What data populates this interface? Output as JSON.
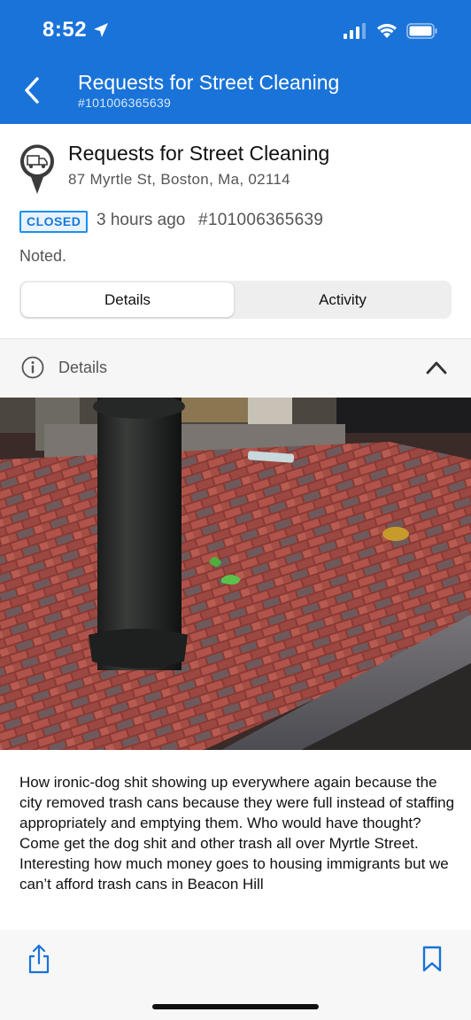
{
  "status_bar": {
    "time": "8:52",
    "icons": [
      "location-arrow-icon",
      "cellular-signal-icon",
      "wifi-icon",
      "battery-icon"
    ]
  },
  "nav": {
    "title": "Requests for Street Cleaning",
    "subtitle": "#101006365639",
    "back_icon": "chevron-left-icon"
  },
  "request": {
    "title": "Requests for Street Cleaning",
    "address": "87 Myrtle St, Boston, Ma, 02114",
    "status": "CLOSED",
    "time_ago": "3 hours ago",
    "case_id": "#101006365639",
    "note": "Noted.",
    "icon": "truck-pin-icon"
  },
  "tabs": [
    {
      "label": "Details",
      "active": true
    },
    {
      "label": "Activity",
      "active": false
    }
  ],
  "details_section": {
    "label": "Details",
    "expanded": true,
    "icon": "info-icon"
  },
  "photo": {
    "subject": "Brick sidewalk at night with a black bollard and litter"
  },
  "description": "How ironic-dog shit showing up everywhere again because the city removed trash cans because they were full instead of staffing appropriately and emptying them. Who would have thought? Come get the dog shit and other trash all over Myrtle Street. Interesting how much money goes to housing immigrants but we can’t afford trash cans in Beacon Hill",
  "bottom_bar": {
    "icons": [
      "share-icon",
      "bookmark-icon"
    ]
  },
  "colors": {
    "header": "#1a73d8",
    "badge_border": "#1a8ff0",
    "badge_text": "#1778d8"
  }
}
